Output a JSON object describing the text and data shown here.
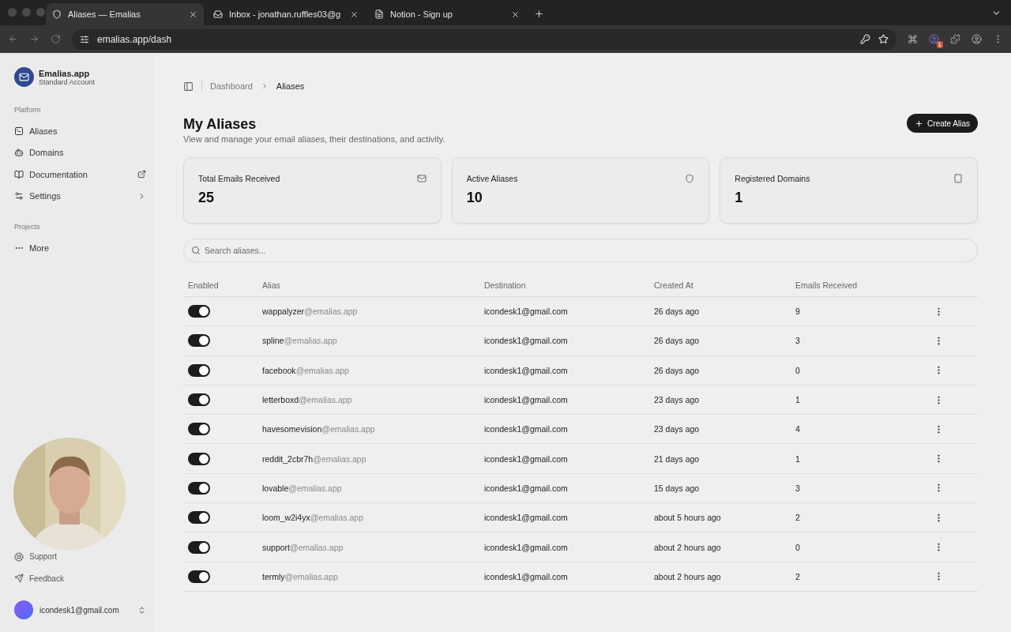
{
  "browser": {
    "tabs": [
      {
        "title": "Aliases — Emalias",
        "selected": true
      },
      {
        "title": "Inbox - jonathan.ruffles03@g",
        "selected": false
      },
      {
        "title": "Notion - Sign up",
        "selected": false
      }
    ],
    "url": "emalias.app/dash",
    "extension_badge": "1"
  },
  "sidebar": {
    "app": {
      "name": "Emalias.app",
      "plan": "Standard Account"
    },
    "platform_label": "Platform",
    "items": [
      {
        "label": "Aliases",
        "kind": "page"
      },
      {
        "label": "Domains",
        "kind": "page"
      },
      {
        "label": "Documentation",
        "kind": "external"
      },
      {
        "label": "Settings",
        "kind": "group"
      }
    ],
    "projects_label": "Projects",
    "more": "More",
    "footer": [
      "Support",
      "Feedback"
    ],
    "user": "icondesk1@gmail.com"
  },
  "breadcrumb": [
    {
      "label": "Dashboard",
      "selected": false
    },
    {
      "label": "Aliases",
      "selected": true
    }
  ],
  "header": {
    "title": "My Aliases",
    "subtitle": "View and manage your email aliases, their destinations, and activity.",
    "button": "Create Alias"
  },
  "stats": [
    {
      "label": "Total Emails Received",
      "value": "25"
    },
    {
      "label": "Active Aliases",
      "value": "10"
    },
    {
      "label": "Registered Domains",
      "value": "1"
    }
  ],
  "search": {
    "placeholder": "Search aliases..."
  },
  "table": {
    "columns": [
      "Enabled",
      "Alias",
      "Destination",
      "Created At",
      "Emails Received"
    ],
    "rows": [
      {
        "enabled": true,
        "alias": "wappalyzer",
        "domain": "@emalias.app",
        "destination": "icondesk1@gmail.com",
        "created": "26 days ago",
        "emails": "9"
      },
      {
        "enabled": true,
        "alias": "spline",
        "domain": "@emalias.app",
        "destination": "icondesk1@gmail.com",
        "created": "26 days ago",
        "emails": "3"
      },
      {
        "enabled": true,
        "alias": "facebook",
        "domain": "@emalias.app",
        "destination": "icondesk1@gmail.com",
        "created": "26 days ago",
        "emails": "0"
      },
      {
        "enabled": true,
        "alias": "letterboxd",
        "domain": "@emalias.app",
        "destination": "icondesk1@gmail.com",
        "created": "23 days ago",
        "emails": "1"
      },
      {
        "enabled": true,
        "alias": "havesomevision",
        "domain": "@emalias.app",
        "destination": "icondesk1@gmail.com",
        "created": "23 days ago",
        "emails": "4"
      },
      {
        "enabled": true,
        "alias": "reddit_2cbr7h",
        "domain": "@emalias.app",
        "destination": "icondesk1@gmail.com",
        "created": "21 days ago",
        "emails": "1"
      },
      {
        "enabled": true,
        "alias": "lovable",
        "domain": "@emalias.app",
        "destination": "icondesk1@gmail.com",
        "created": "15 days ago",
        "emails": "3"
      },
      {
        "enabled": true,
        "alias": "loom_w2i4yx",
        "domain": "@emalias.app",
        "destination": "icondesk1@gmail.com",
        "created": "about 5 hours ago",
        "emails": "2"
      },
      {
        "enabled": true,
        "alias": "support",
        "domain": "@emalias.app",
        "destination": "icondesk1@gmail.com",
        "created": "about 2 hours ago",
        "emails": "0"
      },
      {
        "enabled": true,
        "alias": "termly",
        "domain": "@emalias.app",
        "destination": "icondesk1@gmail.com",
        "created": "about 2 hours ago",
        "emails": "2"
      }
    ]
  }
}
